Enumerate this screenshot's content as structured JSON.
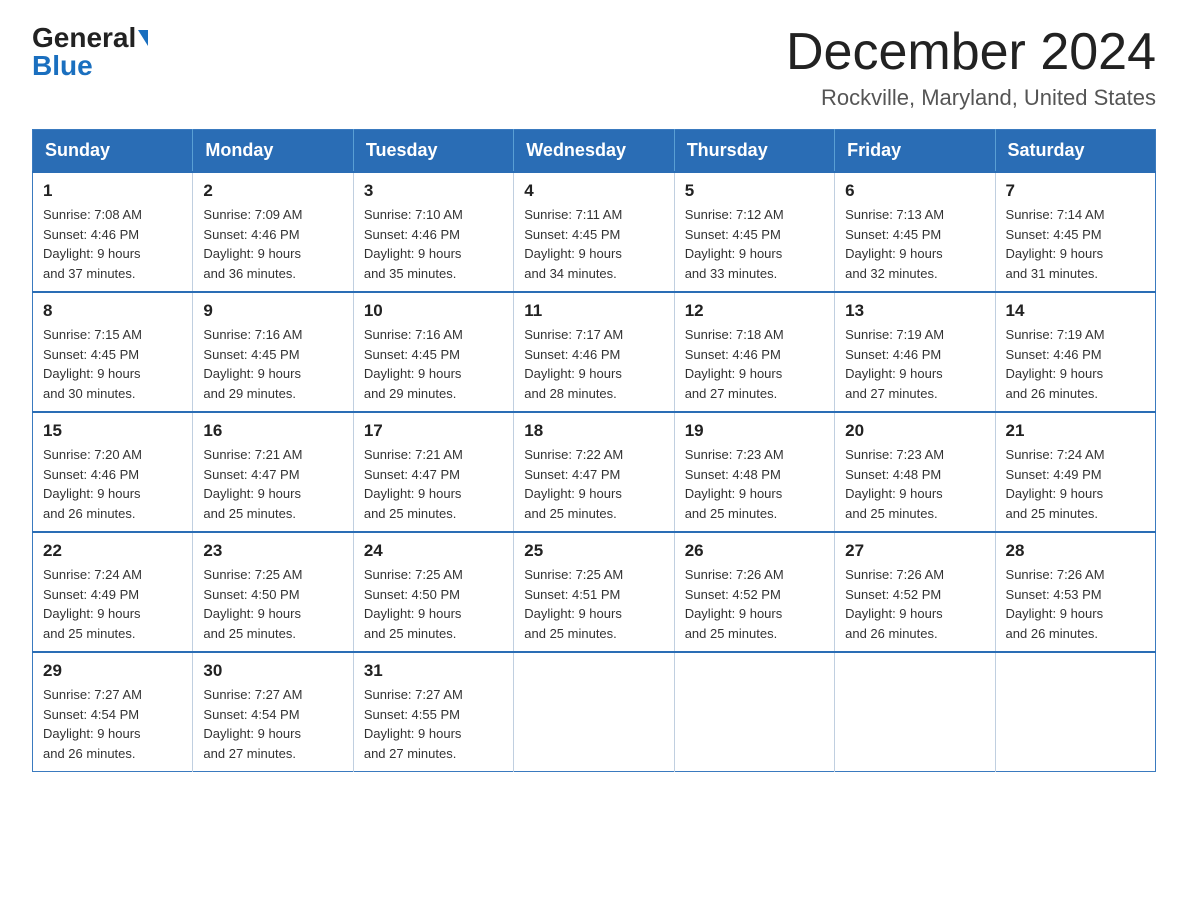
{
  "header": {
    "logo_general": "General",
    "logo_blue": "Blue",
    "month_title": "December 2024",
    "location": "Rockville, Maryland, United States"
  },
  "days_of_week": [
    "Sunday",
    "Monday",
    "Tuesday",
    "Wednesday",
    "Thursday",
    "Friday",
    "Saturday"
  ],
  "weeks": [
    [
      {
        "day": "1",
        "sunrise": "7:08 AM",
        "sunset": "4:46 PM",
        "daylight": "9 hours and 37 minutes."
      },
      {
        "day": "2",
        "sunrise": "7:09 AM",
        "sunset": "4:46 PM",
        "daylight": "9 hours and 36 minutes."
      },
      {
        "day": "3",
        "sunrise": "7:10 AM",
        "sunset": "4:46 PM",
        "daylight": "9 hours and 35 minutes."
      },
      {
        "day": "4",
        "sunrise": "7:11 AM",
        "sunset": "4:45 PM",
        "daylight": "9 hours and 34 minutes."
      },
      {
        "day": "5",
        "sunrise": "7:12 AM",
        "sunset": "4:45 PM",
        "daylight": "9 hours and 33 minutes."
      },
      {
        "day": "6",
        "sunrise": "7:13 AM",
        "sunset": "4:45 PM",
        "daylight": "9 hours and 32 minutes."
      },
      {
        "day": "7",
        "sunrise": "7:14 AM",
        "sunset": "4:45 PM",
        "daylight": "9 hours and 31 minutes."
      }
    ],
    [
      {
        "day": "8",
        "sunrise": "7:15 AM",
        "sunset": "4:45 PM",
        "daylight": "9 hours and 30 minutes."
      },
      {
        "day": "9",
        "sunrise": "7:16 AM",
        "sunset": "4:45 PM",
        "daylight": "9 hours and 29 minutes."
      },
      {
        "day": "10",
        "sunrise": "7:16 AM",
        "sunset": "4:45 PM",
        "daylight": "9 hours and 29 minutes."
      },
      {
        "day": "11",
        "sunrise": "7:17 AM",
        "sunset": "4:46 PM",
        "daylight": "9 hours and 28 minutes."
      },
      {
        "day": "12",
        "sunrise": "7:18 AM",
        "sunset": "4:46 PM",
        "daylight": "9 hours and 27 minutes."
      },
      {
        "day": "13",
        "sunrise": "7:19 AM",
        "sunset": "4:46 PM",
        "daylight": "9 hours and 27 minutes."
      },
      {
        "day": "14",
        "sunrise": "7:19 AM",
        "sunset": "4:46 PM",
        "daylight": "9 hours and 26 minutes."
      }
    ],
    [
      {
        "day": "15",
        "sunrise": "7:20 AM",
        "sunset": "4:46 PM",
        "daylight": "9 hours and 26 minutes."
      },
      {
        "day": "16",
        "sunrise": "7:21 AM",
        "sunset": "4:47 PM",
        "daylight": "9 hours and 25 minutes."
      },
      {
        "day": "17",
        "sunrise": "7:21 AM",
        "sunset": "4:47 PM",
        "daylight": "9 hours and 25 minutes."
      },
      {
        "day": "18",
        "sunrise": "7:22 AM",
        "sunset": "4:47 PM",
        "daylight": "9 hours and 25 minutes."
      },
      {
        "day": "19",
        "sunrise": "7:23 AM",
        "sunset": "4:48 PM",
        "daylight": "9 hours and 25 minutes."
      },
      {
        "day": "20",
        "sunrise": "7:23 AM",
        "sunset": "4:48 PM",
        "daylight": "9 hours and 25 minutes."
      },
      {
        "day": "21",
        "sunrise": "7:24 AM",
        "sunset": "4:49 PM",
        "daylight": "9 hours and 25 minutes."
      }
    ],
    [
      {
        "day": "22",
        "sunrise": "7:24 AM",
        "sunset": "4:49 PM",
        "daylight": "9 hours and 25 minutes."
      },
      {
        "day": "23",
        "sunrise": "7:25 AM",
        "sunset": "4:50 PM",
        "daylight": "9 hours and 25 minutes."
      },
      {
        "day": "24",
        "sunrise": "7:25 AM",
        "sunset": "4:50 PM",
        "daylight": "9 hours and 25 minutes."
      },
      {
        "day": "25",
        "sunrise": "7:25 AM",
        "sunset": "4:51 PM",
        "daylight": "9 hours and 25 minutes."
      },
      {
        "day": "26",
        "sunrise": "7:26 AM",
        "sunset": "4:52 PM",
        "daylight": "9 hours and 25 minutes."
      },
      {
        "day": "27",
        "sunrise": "7:26 AM",
        "sunset": "4:52 PM",
        "daylight": "9 hours and 26 minutes."
      },
      {
        "day": "28",
        "sunrise": "7:26 AM",
        "sunset": "4:53 PM",
        "daylight": "9 hours and 26 minutes."
      }
    ],
    [
      {
        "day": "29",
        "sunrise": "7:27 AM",
        "sunset": "4:54 PM",
        "daylight": "9 hours and 26 minutes."
      },
      {
        "day": "30",
        "sunrise": "7:27 AM",
        "sunset": "4:54 PM",
        "daylight": "9 hours and 27 minutes."
      },
      {
        "day": "31",
        "sunrise": "7:27 AM",
        "sunset": "4:55 PM",
        "daylight": "9 hours and 27 minutes."
      },
      null,
      null,
      null,
      null
    ]
  ]
}
